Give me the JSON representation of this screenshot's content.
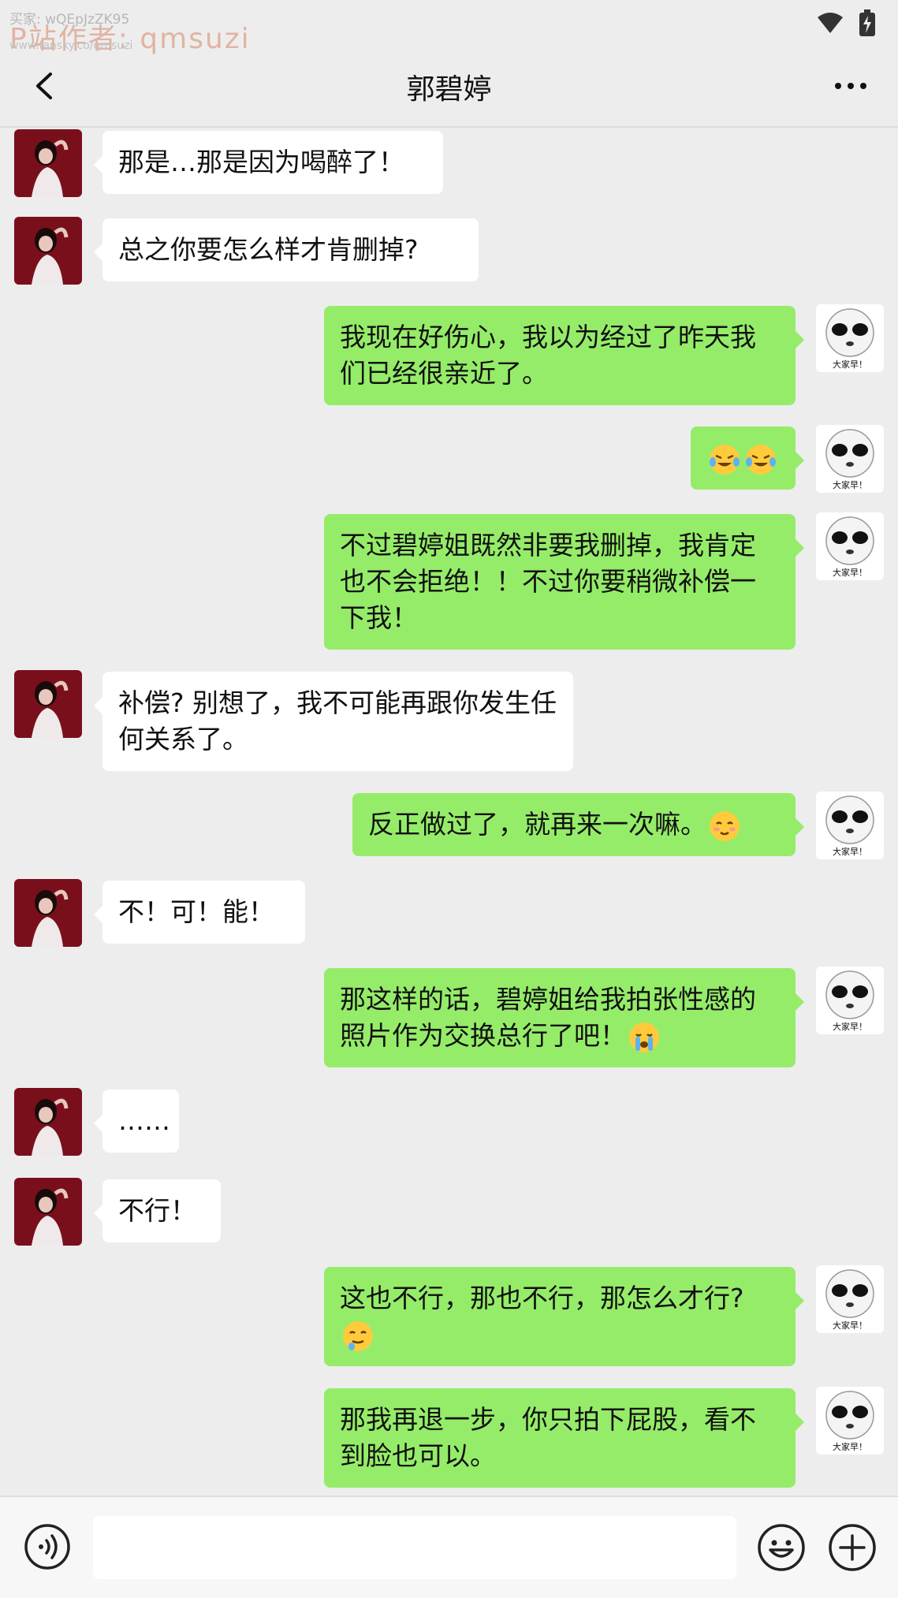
{
  "statusbar": {
    "watermark_code": "买家: wQEpJzZK95",
    "watermark_author": "P站作者: qmsuzi",
    "watermark_url": "www.fansky.co/qmsuzi"
  },
  "header": {
    "title": "郭碧婷"
  },
  "messages": [
    {
      "side": "left",
      "text": "那是…那是因为喝醉了！"
    },
    {
      "side": "left",
      "text": "总之你要怎么样才肯删掉?"
    },
    {
      "side": "right",
      "text": "我现在好伤心，我以为经过了昨天我们已经很亲近了。"
    },
    {
      "side": "right",
      "text": "",
      "emoji": [
        "tears-of-joy",
        "tears-of-joy"
      ]
    },
    {
      "side": "right",
      "text": "不过碧婷姐既然非要我删掉，我肯定也不会拒绝！！不过你要稍微补偿一下我！"
    },
    {
      "side": "left",
      "text": "补偿? 别想了，我不可能再跟你发生任何关系了。"
    },
    {
      "side": "right",
      "text": "反正做过了，就再来一次嘛。",
      "emoji": [
        "blush"
      ]
    },
    {
      "side": "left",
      "text": "不！可！能！"
    },
    {
      "side": "right",
      "text": "那这样的话，碧婷姐给我拍张性感的照片作为交换总行了吧！",
      "emoji": [
        "crying"
      ]
    },
    {
      "side": "left",
      "text": "……"
    },
    {
      "side": "left",
      "text": "不行！"
    },
    {
      "side": "right",
      "text": "这也不行，那也不行，那怎么才行?",
      "emoji": [
        "drooling"
      ]
    },
    {
      "side": "right",
      "text": "那我再退一步，你只拍下屁股，看不到脸也可以。"
    }
  ],
  "avatars": {
    "left": "woman-portrait",
    "right": "panda-meme",
    "right_caption": "大家早！"
  },
  "colors": {
    "background": "#ededed",
    "bubble_self": "#95ec69",
    "bubble_other": "#ffffff"
  },
  "inputbar": {
    "placeholder": ""
  }
}
